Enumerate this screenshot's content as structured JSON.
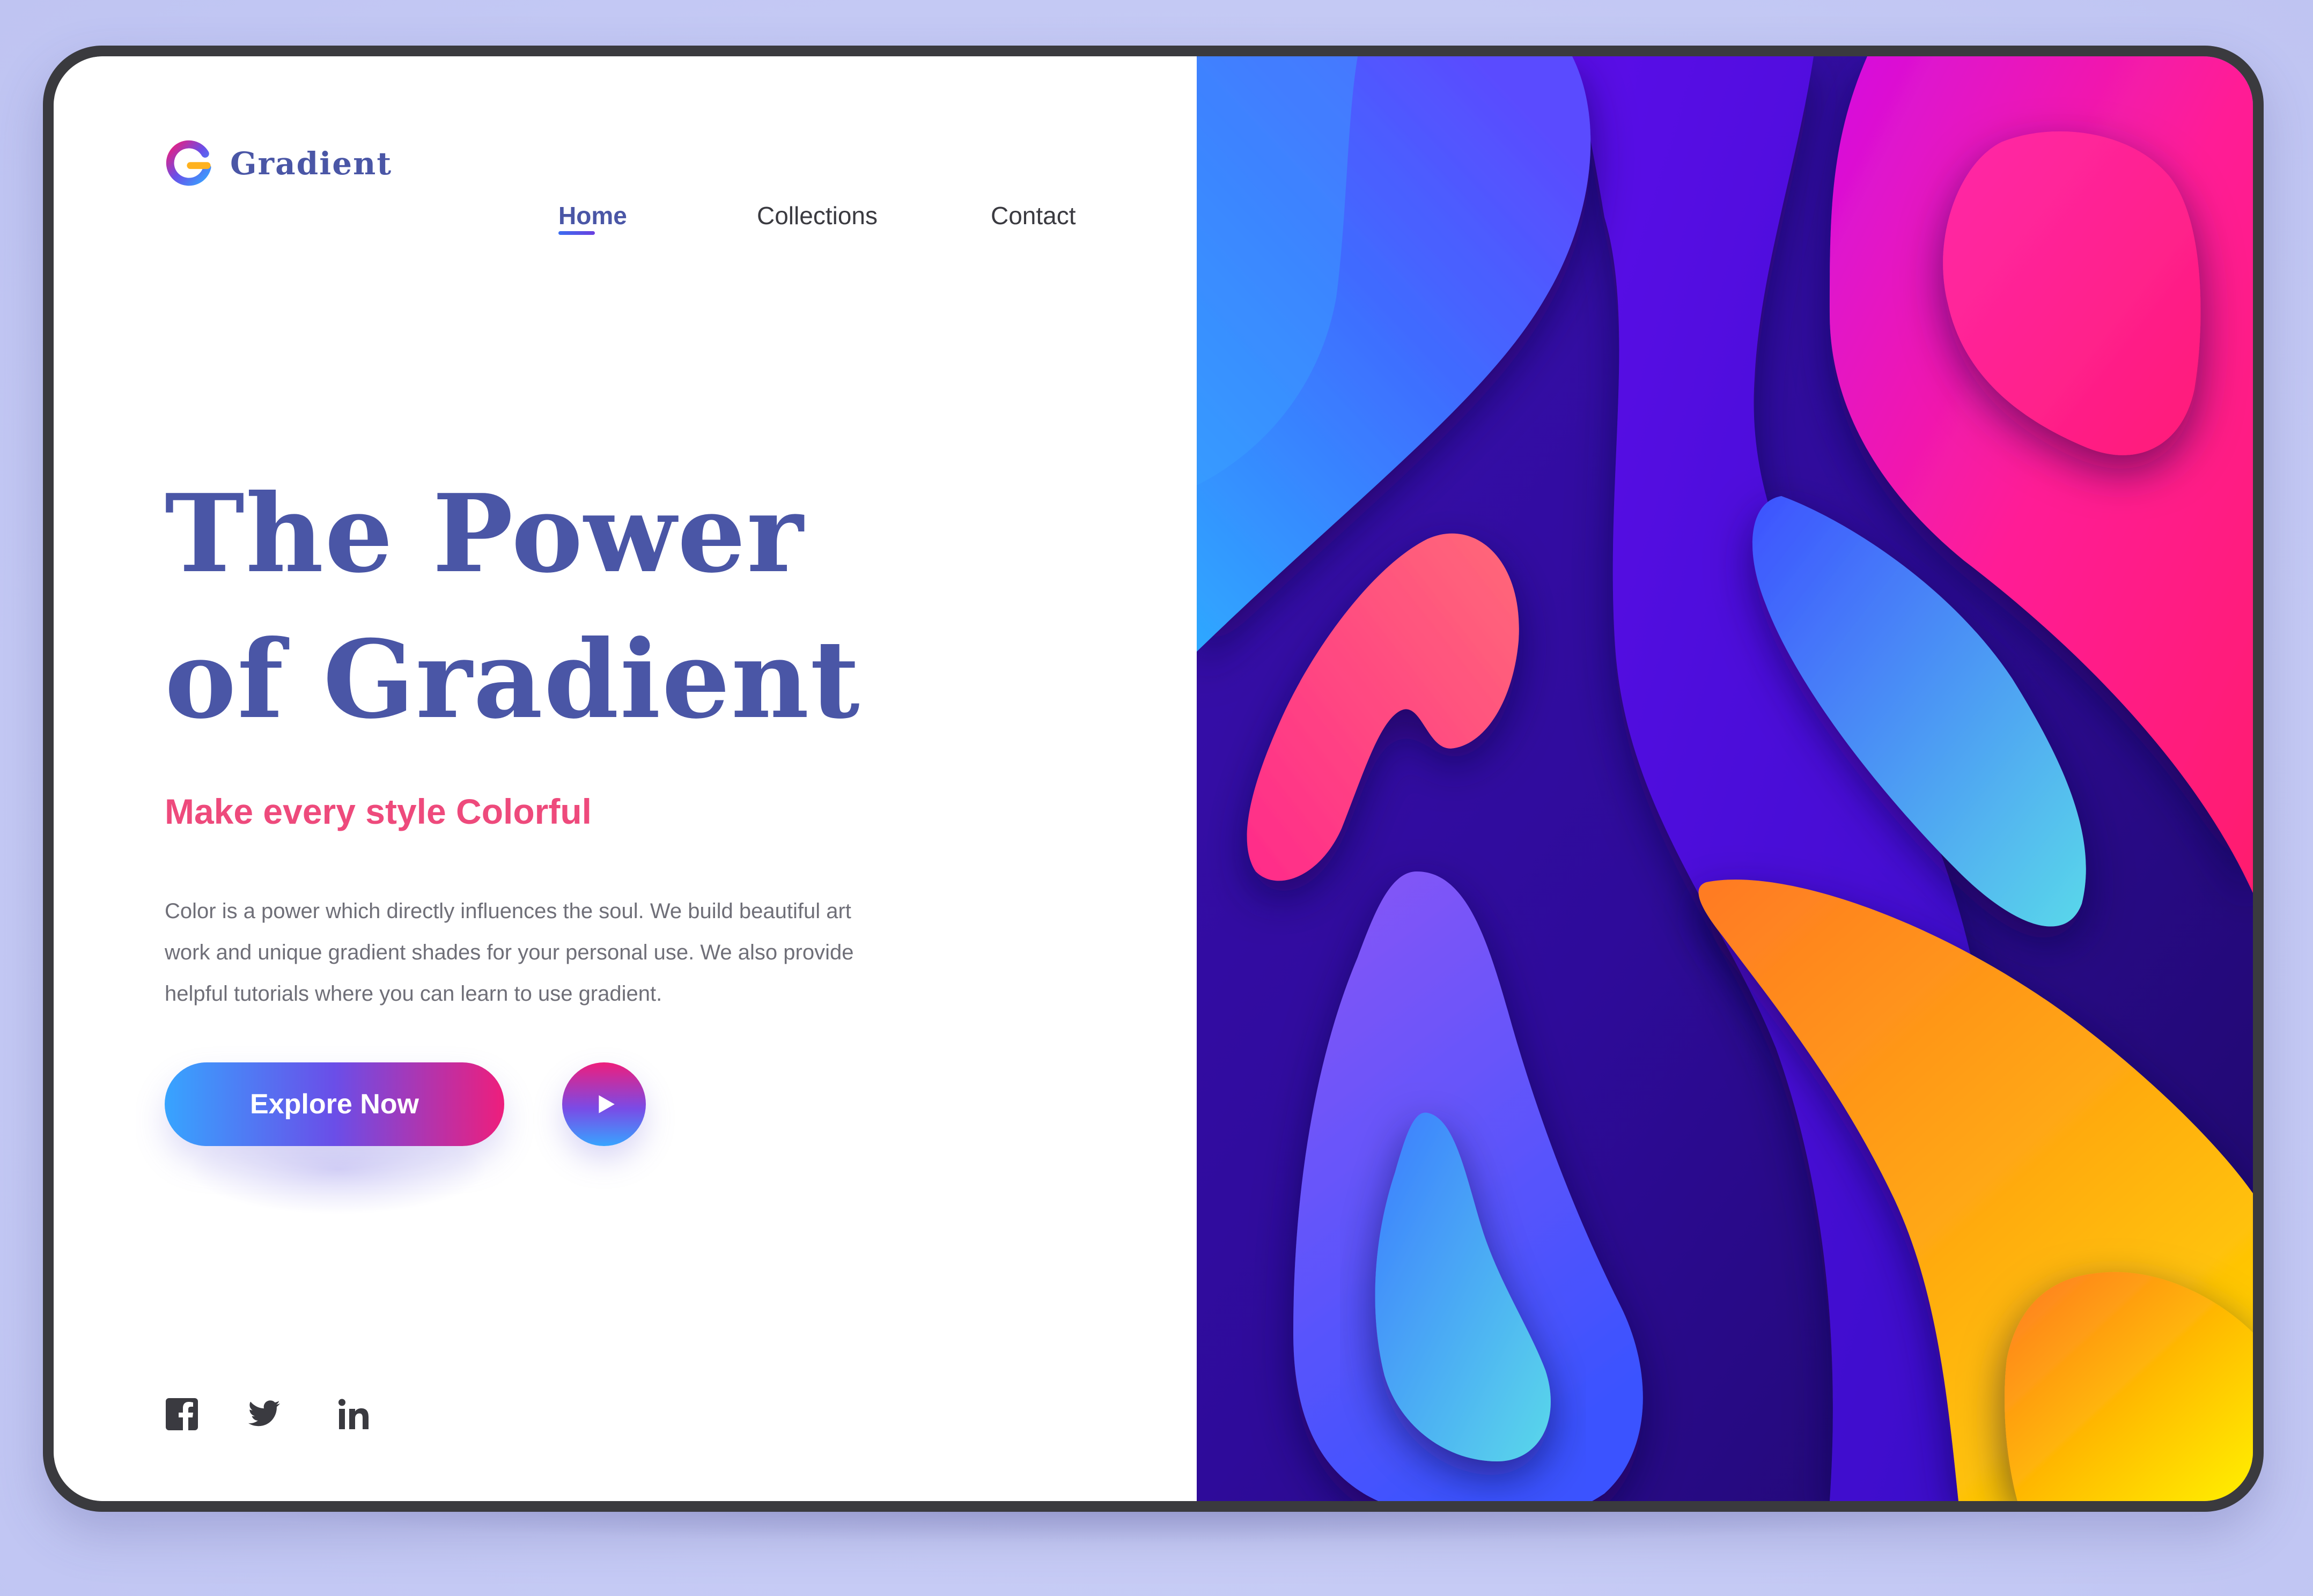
{
  "brand": {
    "name": "Gradient",
    "colors": {
      "primary_text": "#4a56a6",
      "accent_pink": "#ee4a7c",
      "gradient_start": "#37a4ff",
      "gradient_end": "#ee1e7c"
    }
  },
  "nav": {
    "items": [
      {
        "label": "Home",
        "active": true
      },
      {
        "label": "Collections",
        "active": false
      },
      {
        "label": "Contact",
        "active": false
      }
    ]
  },
  "hero": {
    "title_line1": "The Power",
    "title_line2": "of Gradient",
    "subtitle": "Make every style Colorful",
    "body_lines": [
      "Color is a power which directly influences the soul. We build beautiful art",
      "work and unique gradient shades for your personal use. We also provide",
      "helpful tutorials where you can learn to use gradient."
    ]
  },
  "cta": {
    "primary_label": "Explore Now",
    "secondary_icon": "play-icon"
  },
  "social": [
    {
      "icon": "facebook-icon"
    },
    {
      "icon": "twitter-icon"
    },
    {
      "icon": "linkedin-icon"
    }
  ]
}
